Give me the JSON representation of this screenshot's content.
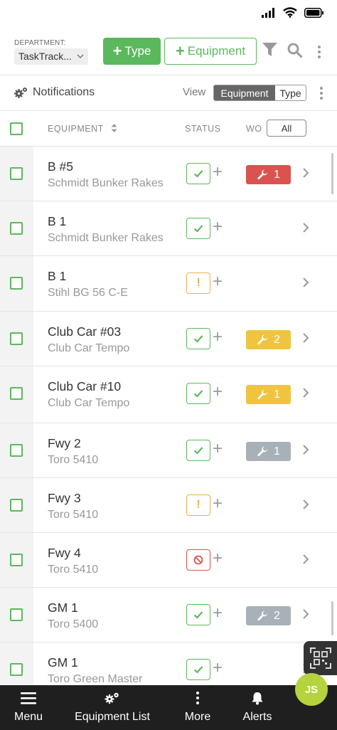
{
  "header": {
    "department_label": "DEPARTMENT:",
    "department_value": "TaskTrack...",
    "add_type_label": "Type",
    "add_equipment_label": "Equipment"
  },
  "subbar": {
    "notifications_label": "Notifications",
    "view_label": "View",
    "view_options": [
      "Equipment",
      "Type"
    ],
    "view_selected": "Equipment"
  },
  "table": {
    "col_equipment": "EQUIPMENT",
    "col_status": "STATUS",
    "col_wo": "WO",
    "wo_filter": "All",
    "rows": [
      {
        "name": "B #5",
        "model": "Schmidt Bunker Rakes",
        "status": "ok",
        "wo": "1",
        "wo_color": "red"
      },
      {
        "name": "B 1",
        "model": "Schmidt Bunker Rakes",
        "status": "ok",
        "wo": "",
        "wo_color": ""
      },
      {
        "name": "B 1",
        "model": "Stihl BG 56 C-E",
        "status": "warn",
        "wo": "",
        "wo_color": ""
      },
      {
        "name": "Club Car #03",
        "model": "Club Car Tempo",
        "status": "ok",
        "wo": "2",
        "wo_color": "yellow"
      },
      {
        "name": "Club Car #10",
        "model": "Club Car Tempo",
        "status": "ok",
        "wo": "1",
        "wo_color": "yellow"
      },
      {
        "name": "Fwy 2",
        "model": "Toro 5410",
        "status": "ok",
        "wo": "1",
        "wo_color": "gray"
      },
      {
        "name": "Fwy 3",
        "model": "Toro 5410",
        "status": "warn",
        "wo": "",
        "wo_color": ""
      },
      {
        "name": "Fwy 4",
        "model": "Toro 5410",
        "status": "down",
        "wo": "",
        "wo_color": ""
      },
      {
        "name": "GM 1",
        "model": "Toro 5400",
        "status": "ok",
        "wo": "2",
        "wo_color": "gray"
      },
      {
        "name": "GM 1",
        "model": "Toro Green Master",
        "status": "ok",
        "wo": "",
        "wo_color": ""
      }
    ]
  },
  "bottom_nav": {
    "menu": "Menu",
    "equipment_list": "Equipment List",
    "more": "More",
    "alerts": "Alerts",
    "avatar_initials": "JS"
  },
  "colors": {
    "primary_green": "#5cb85c",
    "danger_red": "#d9534f",
    "warning_yellow": "#f0c43e",
    "muted_gray": "#a8b1b8",
    "avatar": "#b5d33d"
  }
}
